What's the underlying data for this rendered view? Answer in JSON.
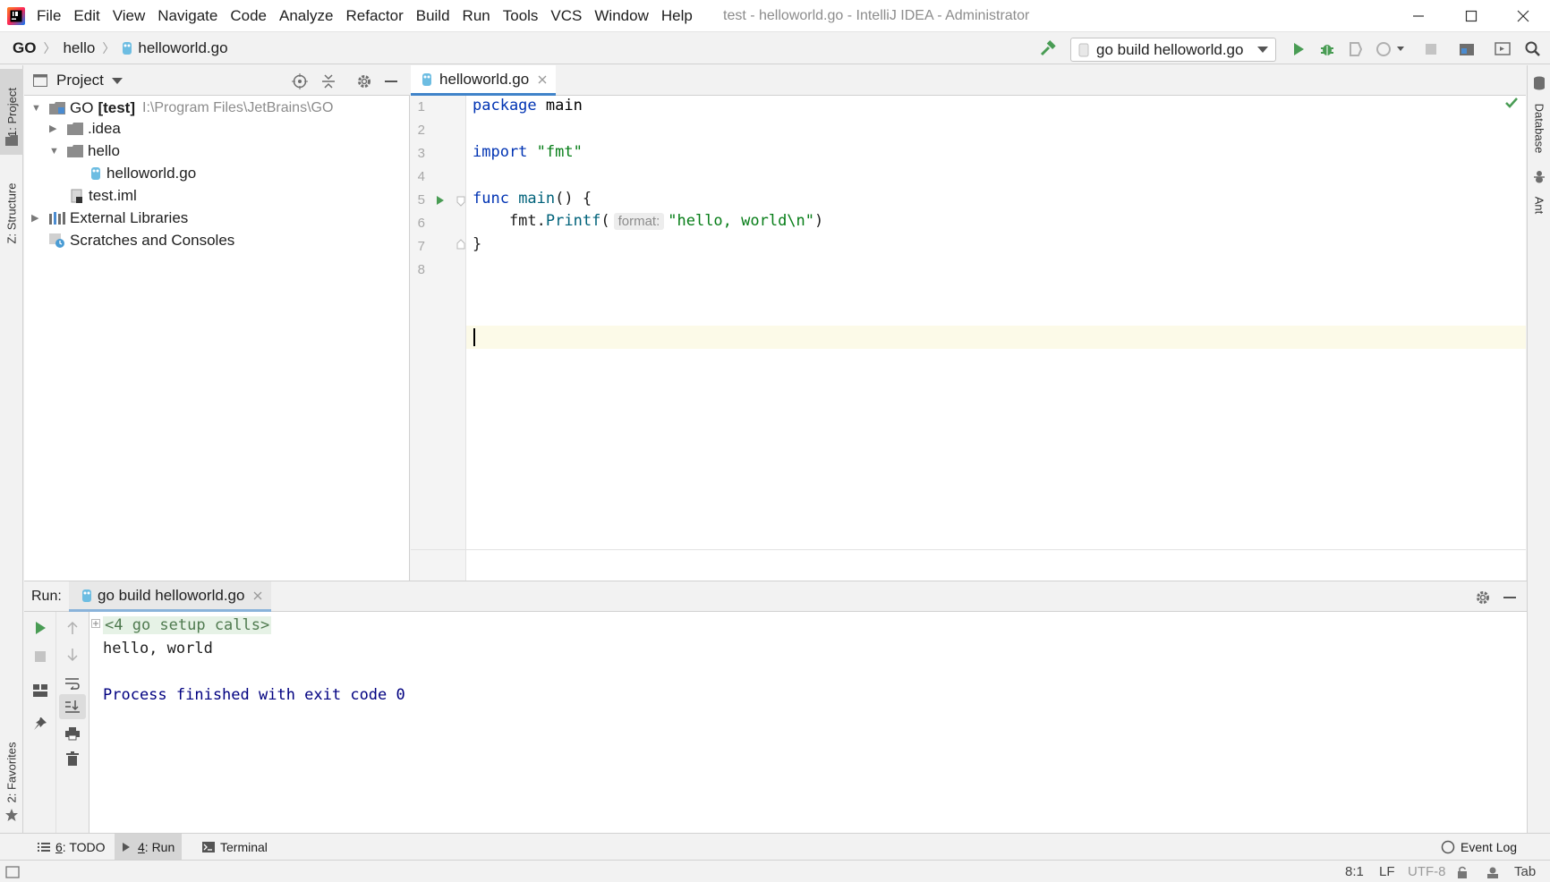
{
  "window": {
    "title": "test - helloworld.go - IntelliJ IDEA - Administrator",
    "app_icon": "intellij-logo-icon"
  },
  "menu": [
    "File",
    "Edit",
    "View",
    "Navigate",
    "Code",
    "Analyze",
    "Refactor",
    "Build",
    "Run",
    "Tools",
    "VCS",
    "Window",
    "Help"
  ],
  "breadcrumb": [
    "GO",
    "hello",
    "helloworld.go"
  ],
  "toolbar": {
    "run_config": "go build helloworld.go"
  },
  "left_stripe": {
    "project": "1: Project",
    "structure": "Z: Structure",
    "favorites": "2: Favorites"
  },
  "right_stripe": {
    "database": "Database",
    "ant": "Ant"
  },
  "project_panel": {
    "title": "Project",
    "tree": [
      {
        "label": "GO",
        "bold": "[test]",
        "path": "I:\\Program Files\\JetBrains\\GO"
      },
      {
        "label": ".idea"
      },
      {
        "label": "hello"
      },
      {
        "label": "helloworld.go"
      },
      {
        "label": "test.iml"
      },
      {
        "label": "External Libraries"
      },
      {
        "label": "Scratches and Consoles"
      }
    ]
  },
  "editor": {
    "tab": "helloworld.go",
    "line_numbers": [
      "1",
      "2",
      "3",
      "4",
      "5",
      "6",
      "7",
      "8"
    ],
    "code": {
      "l1_kw": "package",
      "l1_id": " main",
      "l3_kw": "import",
      "l3_str": " \"fmt\"",
      "l5_kw": "func",
      "l5_fn": " main",
      "l5_rest": "() {",
      "l6_pre": "    fmt.",
      "l6_fn": "Printf",
      "l6_paren": "(",
      "l6_hint": "format:",
      "l6_str": "\"hello, world\\n\"",
      "l6_end": ")",
      "l7": "}"
    }
  },
  "run_panel": {
    "label": "Run:",
    "tab": "go build helloworld.go",
    "console": {
      "setup": "<4 go setup calls>",
      "output": "hello, world",
      "exit": "Process finished with exit code 0"
    }
  },
  "bottom_tabs": {
    "todo_num": "6",
    "todo": ": TODO",
    "run_num": "4",
    "run": ": Run",
    "terminal": "Terminal",
    "event_log": "Event Log"
  },
  "status": {
    "position": "8:1",
    "line_sep": "LF",
    "encoding": "UTF-8",
    "indent": "Tab"
  },
  "colors": {
    "keyword": "#0033b3",
    "string": "#067d17",
    "run_green": "#499c54",
    "console_blue": "#000080"
  }
}
